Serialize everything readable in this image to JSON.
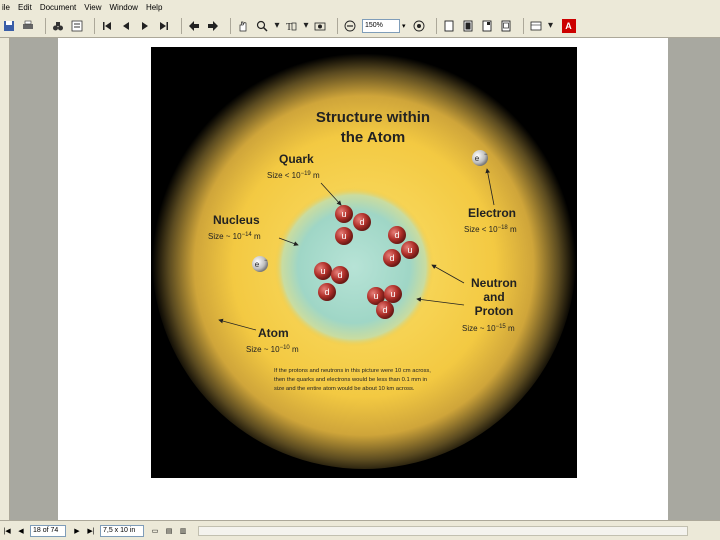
{
  "menu": {
    "items": [
      "ile",
      "Edit",
      "Document",
      "View",
      "Window",
      "Help"
    ]
  },
  "toolbar": {
    "zoom_value": "150%",
    "acrobat_label": "A"
  },
  "figure": {
    "title_line1": "Structure within",
    "title_line2": "the Atom",
    "quark": {
      "label": "Quark",
      "size": "Size < 10",
      "exp": "−19",
      "unit": " m"
    },
    "nucleus": {
      "label": "Nucleus",
      "size": "Size ~ 10",
      "exp": "−14",
      "unit": " m"
    },
    "electron": {
      "label": "Electron",
      "size": "Size < 10",
      "exp": "−18",
      "unit": " m"
    },
    "neutron": {
      "label_line1": "Neutron",
      "label_line2": "and",
      "label_line3": "Proton",
      "size": "Size ~ 10",
      "exp": "−15",
      "unit": " m"
    },
    "atom": {
      "label": "Atom",
      "size": "Size ~ 10",
      "exp": "−10",
      "unit": " m"
    },
    "electron_symbol": "e",
    "electron_charge": "−",
    "caption_line1": "If the protons and neutrons in this picture were 10 cm across,",
    "caption_line2": "then the quarks and electrons would be less than 0.1 mm in",
    "caption_line3": "size and the entire atom would be about 10 km across.",
    "particles": {
      "u": "u",
      "d": "d"
    },
    "colors": {
      "outer_yellow": "#f0c43a",
      "nucleus_teal": "#9fd6c6",
      "particle_red": "#b0302a"
    }
  },
  "statusbar": {
    "page_indicator": "18 of 74",
    "page_size": "7,5 x 10 in"
  }
}
